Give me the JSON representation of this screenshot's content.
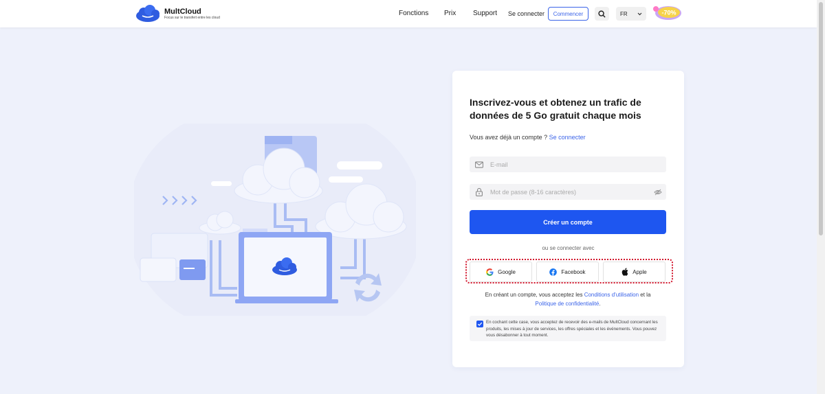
{
  "header": {
    "brand_name": "MultCloud",
    "brand_tagline": "Focus sur le transfert entre les cloud",
    "nav": [
      {
        "label": "Fonctions"
      },
      {
        "label": "Prix"
      },
      {
        "label": "Support"
      }
    ],
    "login_label": "Se connecter",
    "start_label": "Commencer",
    "language": "FR",
    "promo_label": "-70%"
  },
  "form": {
    "title": "Inscrivez-vous et obtenez un trafic de données de 5 Go gratuit chaque mois",
    "have_account_text": "Vous avez déjà un compte ?",
    "have_account_link": "Se connecter",
    "email_placeholder": "E-mail",
    "password_placeholder": "Mot de passe (8-16 caractères)",
    "create_label": "Créer un compte",
    "or_text": "ou se connecter avec",
    "social": [
      {
        "label": "Google",
        "icon": "google-icon"
      },
      {
        "label": "Facebook",
        "icon": "facebook-icon"
      },
      {
        "label": "Apple",
        "icon": "apple-icon"
      }
    ],
    "terms_prefix": "En créant un compte, vous acceptez les",
    "terms_link": "Conditions d'utilisation",
    "terms_and": "et la",
    "privacy_link": "Politique de confidentialité",
    "terms_suffix": ".",
    "consent_text": "En cochant cette case, vous acceptez de recevoir des e-mails de MultCloud concernant les produits, les mises à jour de services, les offres spéciales et les événements. Vous pouvez vous désabonner à tout moment.",
    "consent_checked": true
  },
  "colors": {
    "accent": "#1e56f0",
    "link": "#3a63e8",
    "highlight": "#d2142a",
    "background": "#eef1fb"
  }
}
